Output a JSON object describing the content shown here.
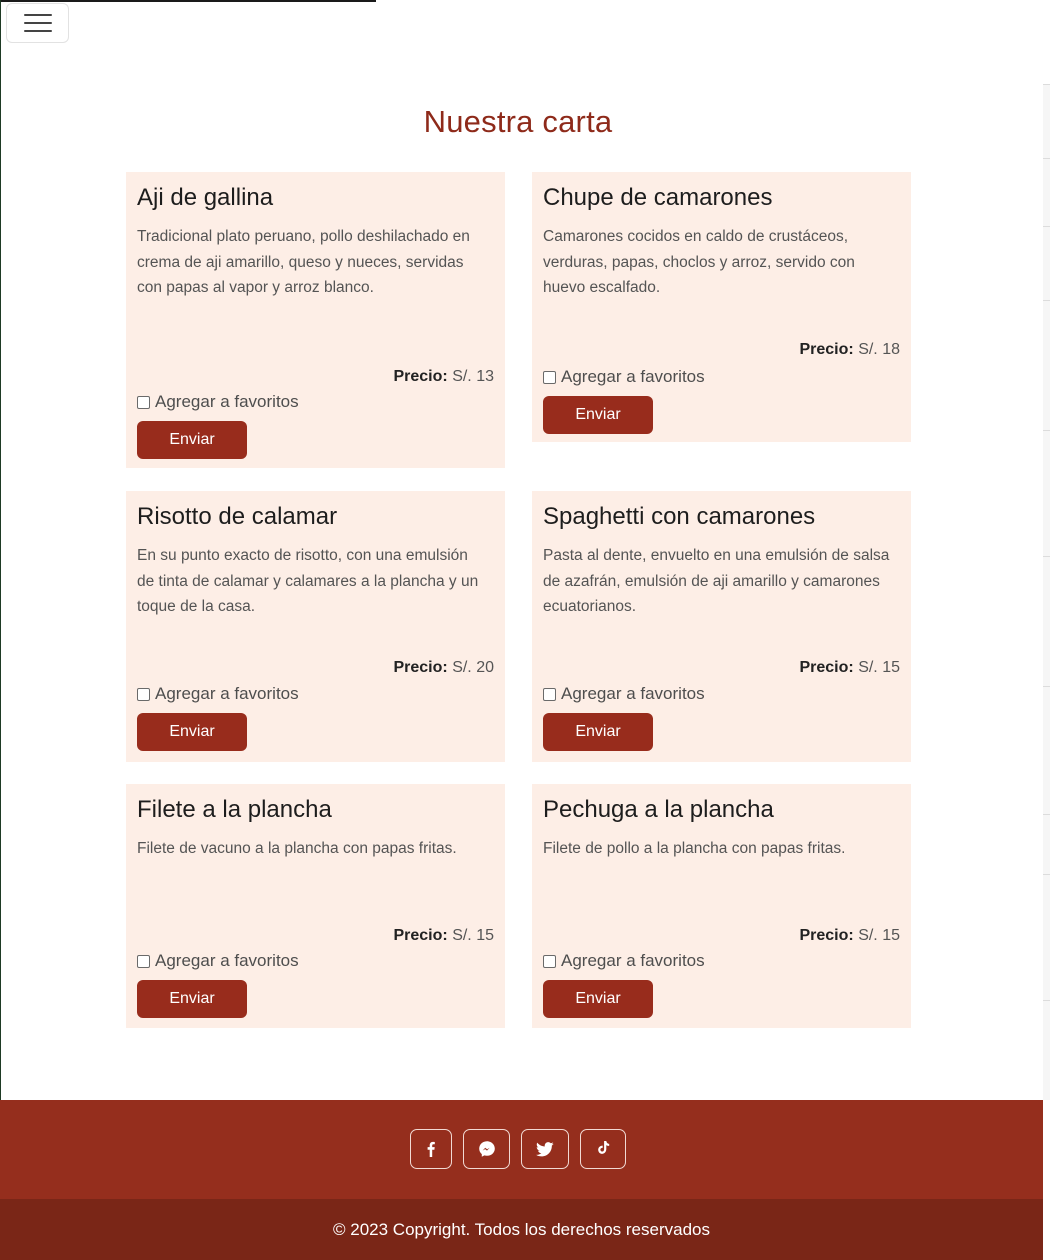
{
  "header": {
    "menu_icon": "hamburger-icon"
  },
  "page": {
    "title": "Nuestra carta"
  },
  "labels": {
    "price_label": "Precio:",
    "favorite_label": "Agregar a favoritos",
    "send_label": "Enviar"
  },
  "menu_items": [
    {
      "name": "Aji de gallina",
      "description": "Tradicional plato peruano, pollo deshilachado en crema de aji amarillo, queso y nueces, servidas con papas al vapor y arroz blanco.",
      "price": "S/. 13",
      "favorite": false
    },
    {
      "name": "Chupe de camarones",
      "description": "Camarones cocidos en caldo de crustáceos, verduras, papas, choclos y arroz, servido con huevo escalfado.",
      "price": "S/. 18",
      "favorite": false
    },
    {
      "name": "Risotto de calamar",
      "description": "En su punto exacto de risotto, con una emulsión de tinta de calamar y calamares a la plancha y un toque de la casa.",
      "price": "S/. 20",
      "favorite": false
    },
    {
      "name": "Spaghetti con camarones",
      "description": "Pasta al dente, envuelto en una emulsión de salsa de azafrán, emulsión de aji amarillo y camarones ecuatorianos.",
      "price": "S/. 15",
      "favorite": false
    },
    {
      "name": "Filete a la plancha",
      "description": "Filete de vacuno a la plancha con papas fritas.",
      "price": "S/. 15",
      "favorite": false
    },
    {
      "name": "Pechuga a la plancha",
      "description": "Filete de pollo a la plancha con papas fritas.",
      "price": "S/. 15",
      "favorite": false
    }
  ],
  "footer": {
    "social": [
      {
        "icon": "facebook-icon"
      },
      {
        "icon": "messenger-icon"
      },
      {
        "icon": "twitter-icon"
      },
      {
        "icon": "tiktok-icon"
      }
    ],
    "copyright": "© 2023 Copyright. Todos los derechos reservados"
  },
  "colors": {
    "accent": "#982c1c",
    "card_bg": "#fdeee6",
    "footer": "#952e1d",
    "footer_bottom": "#7a2617",
    "title": "#8e2a1a"
  }
}
